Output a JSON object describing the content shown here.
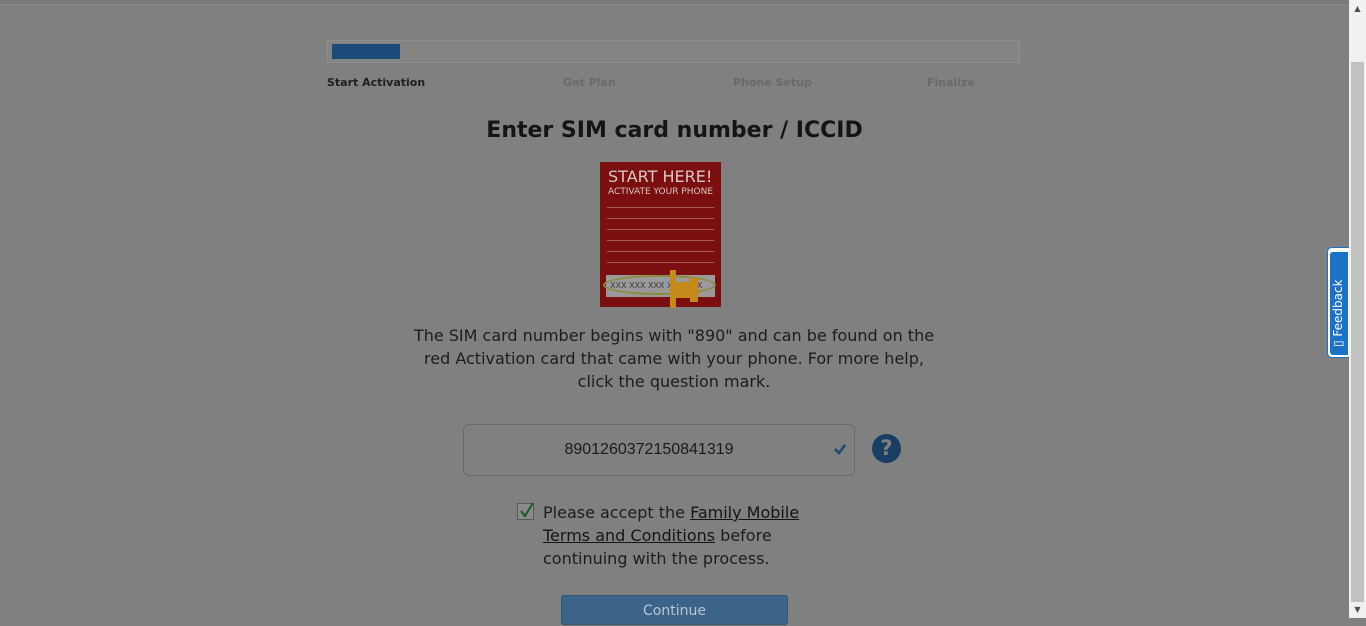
{
  "progress": {
    "percent": 10,
    "steps": [
      "Start Activation",
      "Get Plan",
      "Phone Setup",
      "Finalize"
    ],
    "active_step": 0
  },
  "heading": "Enter SIM card number / ICCID",
  "sim_card_image": {
    "headline": "START HERE!",
    "subline": "ACTIVATE YOUR PHONE",
    "number_mask": "XXX XXX XXX XXX XXX"
  },
  "instruction": "The SIM card number begins with \"890\" and can be found on the red Activation card that came with your phone. For more help, click the question mark.",
  "sim_input": {
    "value": "8901260372150841319"
  },
  "help_button": {
    "label": "?"
  },
  "terms": {
    "checked": true,
    "prefix": "Please accept the ",
    "link_text": "Family Mobile Terms and Conditions",
    "suffix": " before continuing with the process."
  },
  "continue_label": "Continue",
  "feedback_label": "Feedback",
  "colors": {
    "overlay": "#808080",
    "progress_fill": "#1d4b79",
    "help_icon": "#183e63",
    "feedback_accent": "#1a73c6",
    "sim_card_red": "#7b0e0e"
  },
  "icons": [
    "check-icon",
    "help-icon",
    "pointer-hand-icon",
    "feedback-icon",
    "scroll-up-arrow-icon",
    "scroll-down-arrow-icon"
  ]
}
